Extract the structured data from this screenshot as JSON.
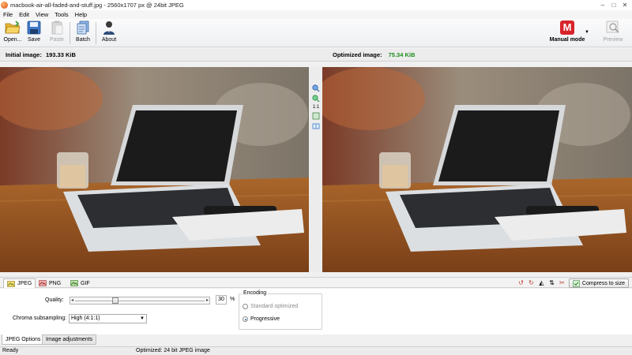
{
  "window": {
    "title": "macbook-air-all-faded-and-stuff.jpg - 2560x1707 px @ 24bit JPEG",
    "controls": [
      "–",
      "□",
      "✕"
    ]
  },
  "menu": [
    "File",
    "Edit",
    "View",
    "Tools",
    "Help"
  ],
  "toolbar": {
    "open_label": "Open...",
    "save_label": "Save",
    "paste_label": "Paste",
    "batch_label": "Batch",
    "about_label": "About",
    "mode_icon_letter": "M",
    "mode_label": "Manual mode",
    "preview_label": "Preview"
  },
  "sizes": {
    "initial_label": "Initial image:",
    "initial_value": "193.33 KiB",
    "optimized_label": "Optimized image:",
    "optimized_value": "75.34 KiB"
  },
  "zoom": {
    "ratio_label": "1:1"
  },
  "formats": {
    "tabs": [
      "JPEG",
      "PNG",
      "GIF"
    ],
    "active": "JPEG",
    "compress_label": "Compress to size"
  },
  "options": {
    "quality_label": "Quality:",
    "quality_value": "30",
    "quality_unit": "%",
    "quality_fraction": 0.3,
    "chroma_label": "Chroma subsampling:",
    "chroma_value": "High (4:1:1)",
    "encoding_label": "Encoding",
    "encoding_options": [
      "Standard optimized",
      "Progressive"
    ],
    "encoding_selected": "Progressive"
  },
  "bottom_tabs": [
    "JPEG Options",
    "Image adjustments"
  ],
  "status": {
    "left": "Ready",
    "center": "Optimized: 24 bit JPEG image"
  },
  "colors": {
    "optimized_size": "#1c8f1c",
    "mode_icon": "#d8232a"
  }
}
